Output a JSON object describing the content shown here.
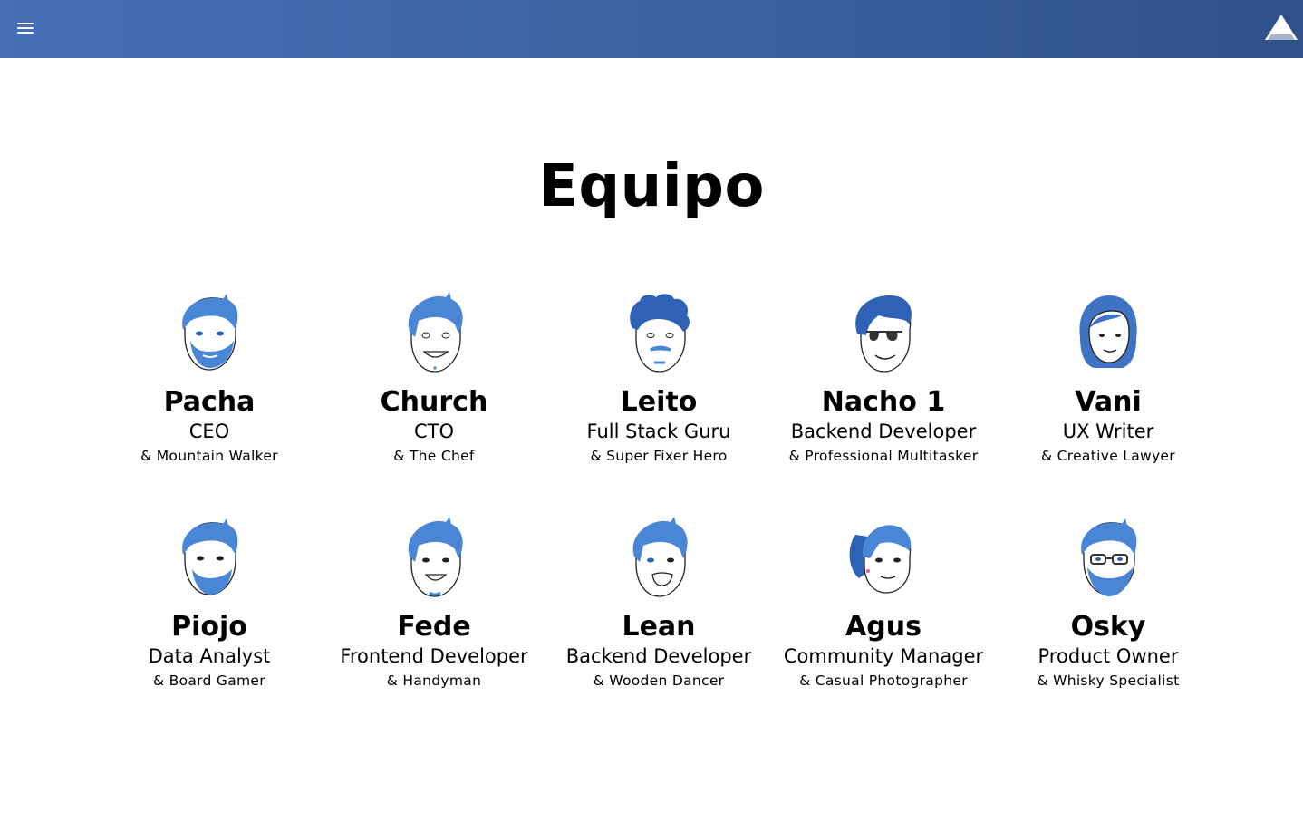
{
  "header": {
    "menu_icon": "hamburger-menu-icon",
    "logo_icon": "triangle-mountain-logo-icon",
    "colors": {
      "gradient_start": "#456fb7",
      "gradient_end": "#2f5188"
    }
  },
  "page": {
    "title": "Equipo"
  },
  "team": [
    {
      "name": "Pacha",
      "role": "CEO",
      "hobby": "& Mountain Walker",
      "avatar": "bearded-man-avatar-icon"
    },
    {
      "name": "Church",
      "role": "CTO",
      "hobby": "& The Chef",
      "avatar": "smiling-spiky-hair-man-avatar-icon"
    },
    {
      "name": "Leito",
      "role": "Full Stack Guru",
      "hobby": "& Super Fixer Hero",
      "avatar": "curly-hair-mustache-man-avatar-icon"
    },
    {
      "name": "Nacho 1",
      "role": "Backend Developer",
      "hobby": "& Professional Multitasker",
      "avatar": "sunglasses-man-avatar-icon"
    },
    {
      "name": "Vani",
      "role": "UX Writer",
      "hobby": "& Creative Lawyer",
      "avatar": "woman-avatar-icon"
    },
    {
      "name": "Piojo",
      "role": "Data Analyst",
      "hobby": "& Board Gamer",
      "avatar": "bearded-man-avatar-icon"
    },
    {
      "name": "Fede",
      "role": "Frontend Developer",
      "hobby": "& Handyman",
      "avatar": "smiling-man-avatar-icon"
    },
    {
      "name": "Lean",
      "role": "Backend Developer",
      "hobby": "& Wooden Dancer",
      "avatar": "grinning-man-avatar-icon"
    },
    {
      "name": "Agus",
      "role": "Community Manager",
      "hobby": "& Casual Photographer",
      "avatar": "ponytail-woman-avatar-icon"
    },
    {
      "name": "Osky",
      "role": "Product Owner",
      "hobby": "& Whisky Specialist",
      "avatar": "glasses-bearded-man-avatar-icon"
    }
  ]
}
